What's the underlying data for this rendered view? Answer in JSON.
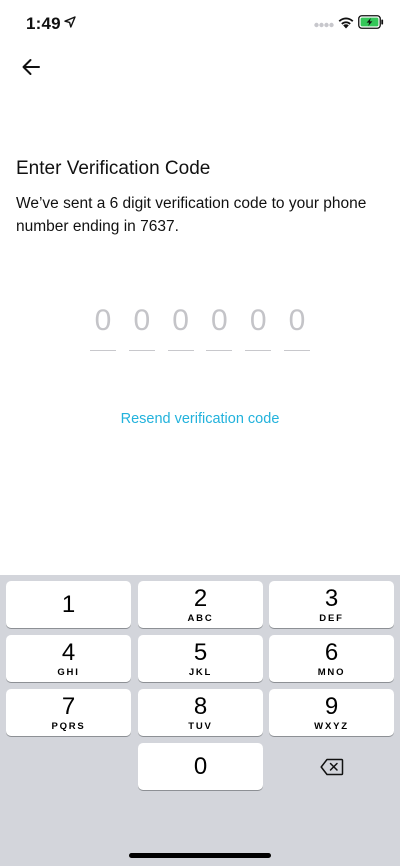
{
  "status_bar": {
    "time": "1:49"
  },
  "header": {
    "back_icon": "arrow-left-icon"
  },
  "content": {
    "title": "Enter Verification Code",
    "description": "We’ve sent a 6 digit verification code to your phone number ending in 7637.",
    "code_placeholder": [
      "0",
      "0",
      "0",
      "0",
      "0",
      "0"
    ],
    "resend_label": "Resend verification code"
  },
  "keypad": {
    "keys": [
      {
        "digit": "1",
        "letters": ""
      },
      {
        "digit": "2",
        "letters": "ABC"
      },
      {
        "digit": "3",
        "letters": "DEF"
      },
      {
        "digit": "4",
        "letters": "GHI"
      },
      {
        "digit": "5",
        "letters": "JKL"
      },
      {
        "digit": "6",
        "letters": "MNO"
      },
      {
        "digit": "7",
        "letters": "PQRS"
      },
      {
        "digit": "8",
        "letters": "TUV"
      },
      {
        "digit": "9",
        "letters": "WXYZ"
      },
      {
        "digit": "0",
        "letters": ""
      }
    ]
  },
  "colors": {
    "accent": "#22b2dc",
    "keypad_bg": "#d3d5db",
    "battery_green": "#34c759"
  }
}
